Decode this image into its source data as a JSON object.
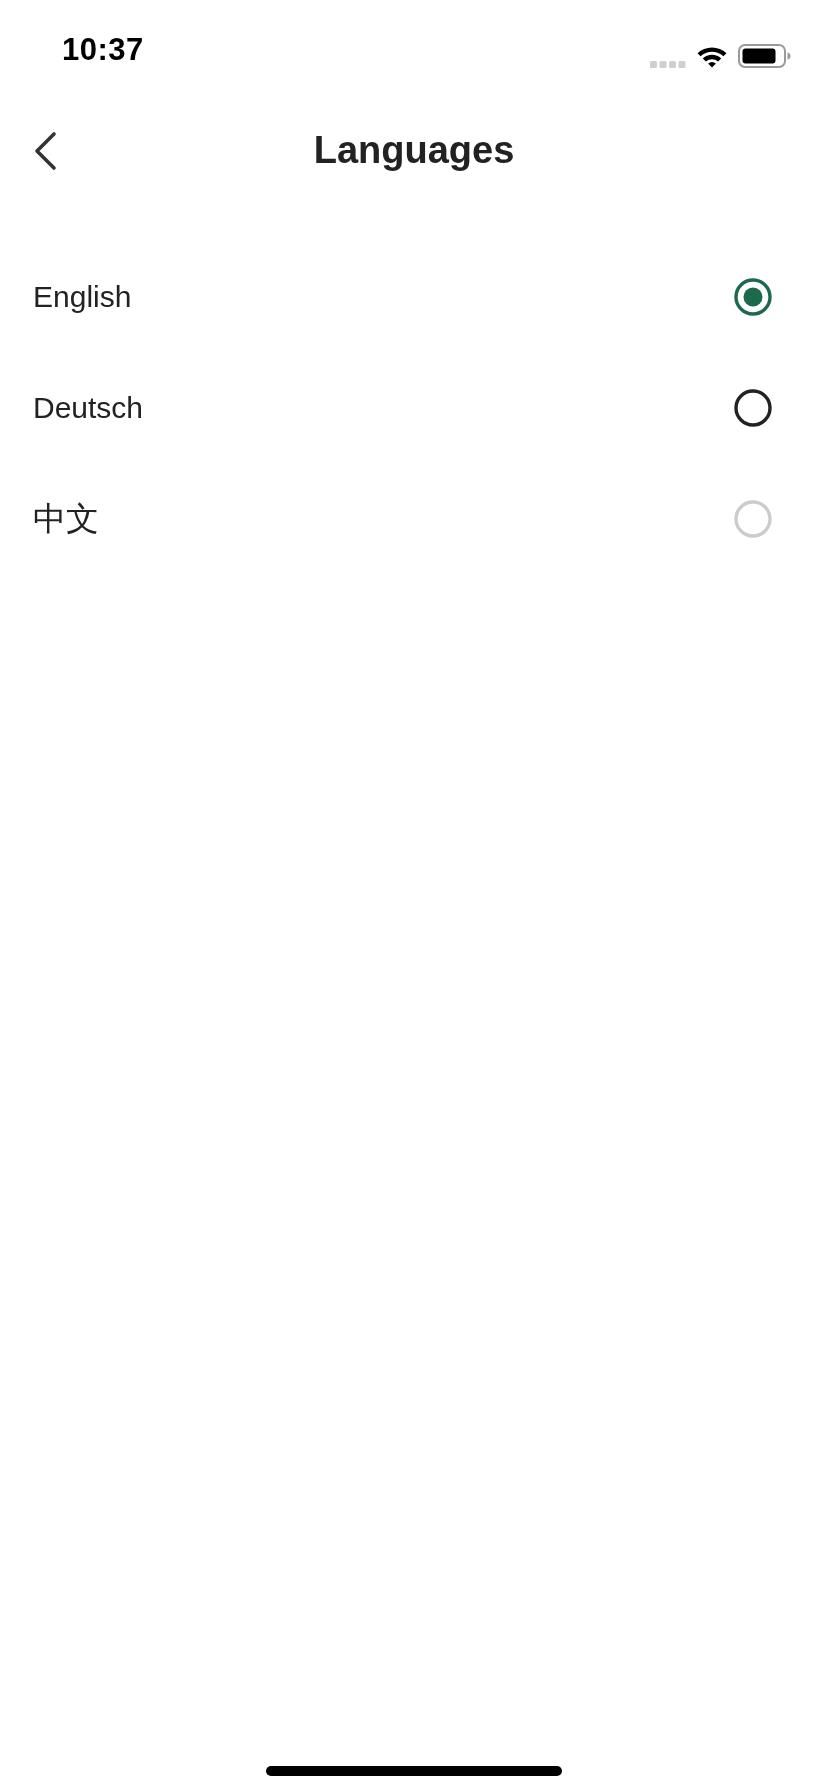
{
  "status_bar": {
    "time": "10:37"
  },
  "header": {
    "title": "Languages"
  },
  "languages": [
    {
      "label": "English",
      "selected": true,
      "disabled": false
    },
    {
      "label": "Deutsch",
      "selected": false,
      "disabled": false
    },
    {
      "label": "中文",
      "selected": false,
      "disabled": true
    }
  ]
}
